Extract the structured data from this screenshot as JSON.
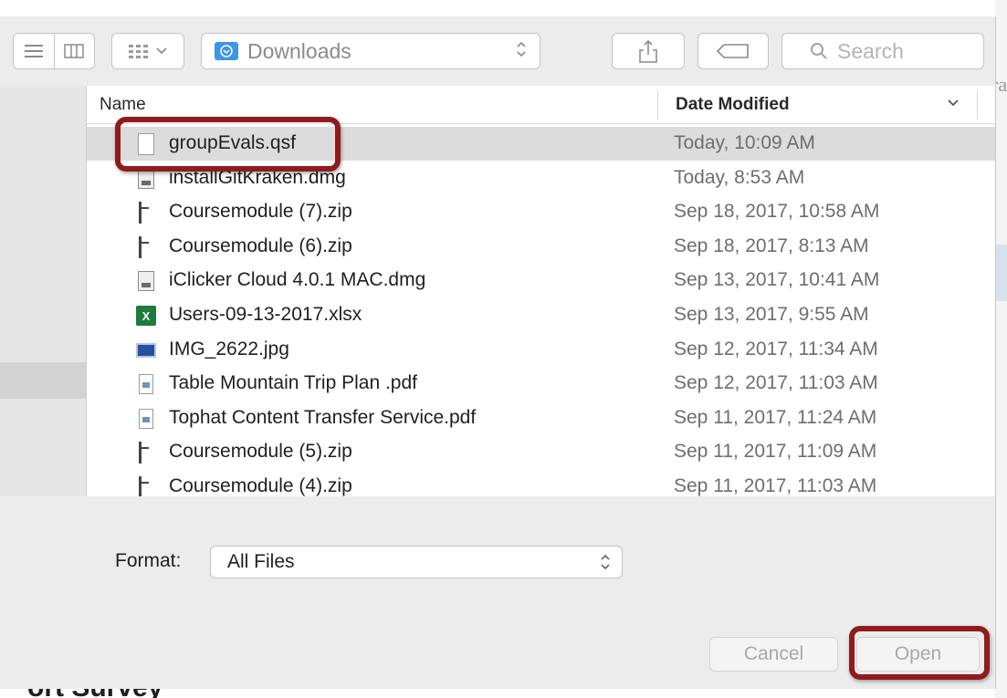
{
  "toolbar": {
    "location": "Downloads",
    "search_placeholder": "Search"
  },
  "columns": {
    "name": "Name",
    "date": "Date Modified"
  },
  "files": [
    {
      "name": "groupEvals.qsf",
      "date": "Today, 10:09 AM",
      "icon": "document-icon",
      "selected": true
    },
    {
      "name": "installGitKraken.dmg",
      "date": "Today, 8:53 AM",
      "icon": "disk-image-icon"
    },
    {
      "name": "Coursemodule (7).zip",
      "date": "Sep 18, 2017, 10:58 AM",
      "icon": "zip-icon"
    },
    {
      "name": "Coursemodule (6).zip",
      "date": "Sep 18, 2017, 8:13 AM",
      "icon": "zip-icon"
    },
    {
      "name": "iClicker Cloud 4.0.1 MAC.dmg",
      "date": "Sep 13, 2017, 10:41 AM",
      "icon": "disk-image-icon"
    },
    {
      "name": "Users-09-13-2017.xlsx",
      "date": "Sep 13, 2017, 9:55 AM",
      "icon": "excel-icon"
    },
    {
      "name": "IMG_2622.jpg",
      "date": "Sep 12, 2017, 11:34 AM",
      "icon": "image-icon"
    },
    {
      "name": "Table Mountain Trip Plan .pdf",
      "date": "Sep 12, 2017, 11:03 AM",
      "icon": "pdf-icon"
    },
    {
      "name": "Tophat Content Transfer Service.pdf",
      "date": "Sep 11, 2017, 11:24 AM",
      "icon": "pdf-icon"
    },
    {
      "name": "Coursemodule (5).zip",
      "date": "Sep 11, 2017, 11:09 AM",
      "icon": "zip-icon"
    },
    {
      "name": "Coursemodule (4).zip",
      "date": "Sep 11, 2017, 11:03 AM",
      "icon": "zip-icon"
    }
  ],
  "format": {
    "label": "Format:",
    "value": "All Files"
  },
  "buttons": {
    "cancel": "Cancel",
    "open": "Open"
  },
  "background": {
    "heading_fragment": "ort Survey",
    "side_fragment": "ra"
  },
  "colors": {
    "highlight": "#8e1c1c",
    "folder": "#3c95e6",
    "selection": "#dcdcdc"
  }
}
